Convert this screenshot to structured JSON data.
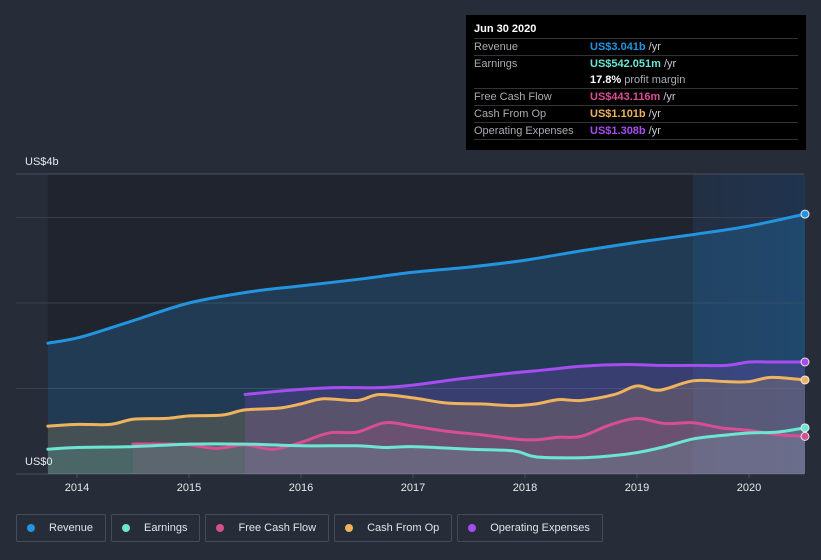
{
  "tooltip": {
    "date": "Jun 30 2020",
    "rows": [
      {
        "label": "Revenue",
        "value": "US$3.041b",
        "unit": "/yr",
        "color": "#2394df"
      },
      {
        "label": "Earnings",
        "value": "US$542.051m",
        "unit": "/yr",
        "color": "#6ce5d1"
      },
      {
        "label": "",
        "value": "17.8%",
        "unit": "profit margin",
        "color": "#ffffff"
      },
      {
        "label": "Free Cash Flow",
        "value": "US$443.116m",
        "unit": "/yr",
        "color": "#d84e92"
      },
      {
        "label": "Cash From Op",
        "value": "US$1.101b",
        "unit": "/yr",
        "color": "#efb35e"
      },
      {
        "label": "Operating Expenses",
        "value": "US$1.308b",
        "unit": "/yr",
        "color": "#a64df0"
      }
    ]
  },
  "legend": [
    {
      "label": "Revenue",
      "color": "#2394df"
    },
    {
      "label": "Earnings",
      "color": "#6ce5d1"
    },
    {
      "label": "Free Cash Flow",
      "color": "#d84e92"
    },
    {
      "label": "Cash From Op",
      "color": "#efb35e"
    },
    {
      "label": "Operating Expenses",
      "color": "#a64df0"
    }
  ],
  "chart_data": {
    "type": "area",
    "title": "",
    "xlabel": "",
    "ylabel": "",
    "y_tick_labels": {
      "top": "US$4b",
      "bottom": "US$0"
    },
    "ylim": [
      0,
      3.5
    ],
    "xlim": [
      2013.7,
      2020.5
    ],
    "x_ticks": [
      "2014",
      "2015",
      "2016",
      "2017",
      "2018",
      "2019",
      "2020"
    ],
    "grid": true,
    "legend_position": "bottom-left",
    "highlight_range": [
      2019.5,
      2020.5
    ],
    "units": "US$ billions",
    "series": [
      {
        "name": "Revenue",
        "color": "#2394df",
        "x": [
          2013.74,
          2014.03,
          2014.47,
          2015.0,
          2015.54,
          2016.0,
          2016.53,
          2017.0,
          2017.5,
          2018.0,
          2018.5,
          2019.0,
          2019.5,
          2020.0,
          2020.5
        ],
        "y": [
          1.53,
          1.6,
          1.78,
          2.0,
          2.13,
          2.2,
          2.28,
          2.36,
          2.42,
          2.5,
          2.61,
          2.71,
          2.8,
          2.9,
          3.04
        ]
      },
      {
        "name": "Operating Expenses",
        "color": "#a64df0",
        "x": [
          2015.5,
          2015.9,
          2016.3,
          2016.7,
          2017.0,
          2017.4,
          2017.8,
          2018.2,
          2018.5,
          2018.9,
          2019.2,
          2019.5,
          2019.8,
          2020.0,
          2020.2,
          2020.5
        ],
        "y": [
          0.93,
          0.98,
          1.01,
          1.01,
          1.04,
          1.11,
          1.17,
          1.22,
          1.26,
          1.28,
          1.27,
          1.27,
          1.27,
          1.31,
          1.31,
          1.31
        ]
      },
      {
        "name": "Cash From Op",
        "color": "#efb35e",
        "x": [
          2013.74,
          2014.0,
          2014.3,
          2014.5,
          2014.8,
          2015.0,
          2015.3,
          2015.5,
          2015.8,
          2016.0,
          2016.2,
          2016.5,
          2016.7,
          2017.0,
          2017.3,
          2017.6,
          2017.9,
          2018.1,
          2018.3,
          2018.5,
          2018.8,
          2019.0,
          2019.2,
          2019.5,
          2019.8,
          2020.0,
          2020.2,
          2020.5
        ],
        "y": [
          0.56,
          0.58,
          0.58,
          0.64,
          0.65,
          0.68,
          0.69,
          0.75,
          0.77,
          0.82,
          0.88,
          0.86,
          0.93,
          0.89,
          0.83,
          0.82,
          0.8,
          0.82,
          0.87,
          0.86,
          0.93,
          1.03,
          0.98,
          1.09,
          1.08,
          1.08,
          1.13,
          1.1
        ]
      },
      {
        "name": "Free Cash Flow",
        "color": "#d84e92",
        "x": [
          2014.5,
          2014.8,
          2015.0,
          2015.25,
          2015.5,
          2015.75,
          2016.0,
          2016.25,
          2016.5,
          2016.75,
          2017.0,
          2017.3,
          2017.6,
          2017.9,
          2018.1,
          2018.3,
          2018.5,
          2018.75,
          2019.0,
          2019.25,
          2019.5,
          2019.75,
          2020.0,
          2020.25,
          2020.5
        ],
        "y": [
          0.35,
          0.35,
          0.34,
          0.3,
          0.34,
          0.29,
          0.37,
          0.48,
          0.49,
          0.6,
          0.56,
          0.5,
          0.46,
          0.41,
          0.4,
          0.43,
          0.44,
          0.57,
          0.65,
          0.59,
          0.6,
          0.54,
          0.51,
          0.46,
          0.44
        ]
      },
      {
        "name": "Earnings",
        "color": "#6ce5d1",
        "x": [
          2013.74,
          2014.0,
          2014.5,
          2015.0,
          2015.5,
          2016.0,
          2016.5,
          2016.75,
          2017.0,
          2017.5,
          2017.9,
          2018.1,
          2018.5,
          2018.75,
          2019.0,
          2019.25,
          2019.5,
          2019.75,
          2020.0,
          2020.25,
          2020.5
        ],
        "y": [
          0.29,
          0.31,
          0.32,
          0.35,
          0.35,
          0.33,
          0.33,
          0.31,
          0.32,
          0.29,
          0.27,
          0.2,
          0.19,
          0.21,
          0.25,
          0.32,
          0.41,
          0.45,
          0.48,
          0.49,
          0.54
        ]
      }
    ]
  }
}
